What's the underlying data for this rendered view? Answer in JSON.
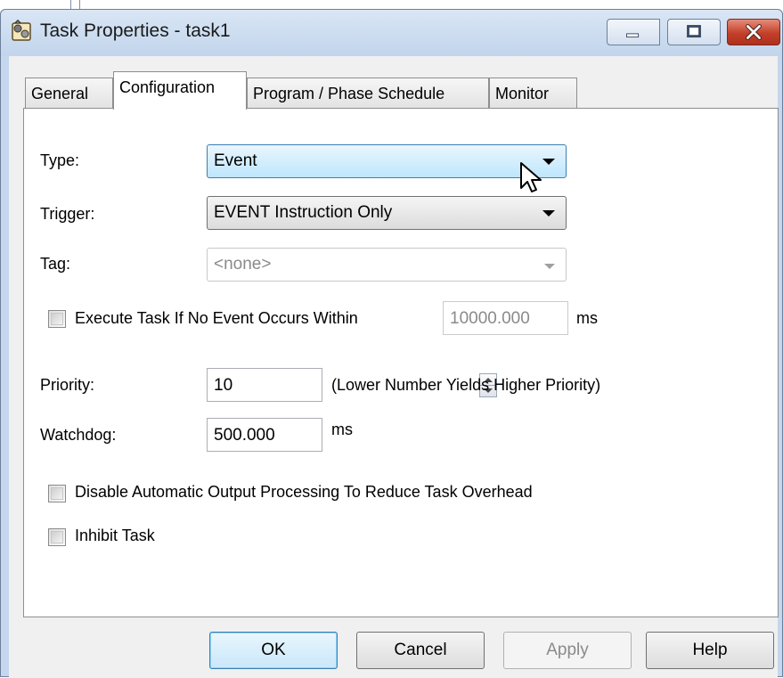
{
  "window": {
    "title": "Task Properties - task1",
    "title_icon": "task-properties-icon",
    "controls": {
      "minimize": "minimize-icon",
      "maximize": "maximize-icon",
      "close": "close-icon"
    }
  },
  "tabs": [
    {
      "label": "General",
      "active": false
    },
    {
      "label": "Configuration",
      "active": true
    },
    {
      "label": "Program / Phase Schedule",
      "active": false
    },
    {
      "label": "Monitor",
      "active": false
    }
  ],
  "config": {
    "type": {
      "label": "Type:",
      "value": "Event"
    },
    "trigger": {
      "label": "Trigger:",
      "value": "EVENT Instruction Only"
    },
    "tag": {
      "label": "Tag:",
      "value": "<none>"
    },
    "execute_if_no_event": {
      "label": "Execute Task If No Event Occurs Within",
      "checked": false,
      "value": "10000.000",
      "unit": "ms"
    },
    "priority": {
      "label": "Priority:",
      "value": "10",
      "hint": "(Lower Number Yields Higher Priority)"
    },
    "watchdog": {
      "label": "Watchdog:",
      "value": "500.000",
      "unit": "ms"
    },
    "disable_output_processing": {
      "label": "Disable Automatic Output Processing To Reduce Task Overhead",
      "checked": false
    },
    "inhibit_task": {
      "label": "Inhibit Task",
      "checked": false
    }
  },
  "buttons": {
    "ok": "OK",
    "cancel": "Cancel",
    "apply": "Apply",
    "help": "Help"
  },
  "colors": {
    "accent_focus": "#3c7fb1",
    "close_button": "#c2402a",
    "titlebar": "#c4d7ee"
  }
}
